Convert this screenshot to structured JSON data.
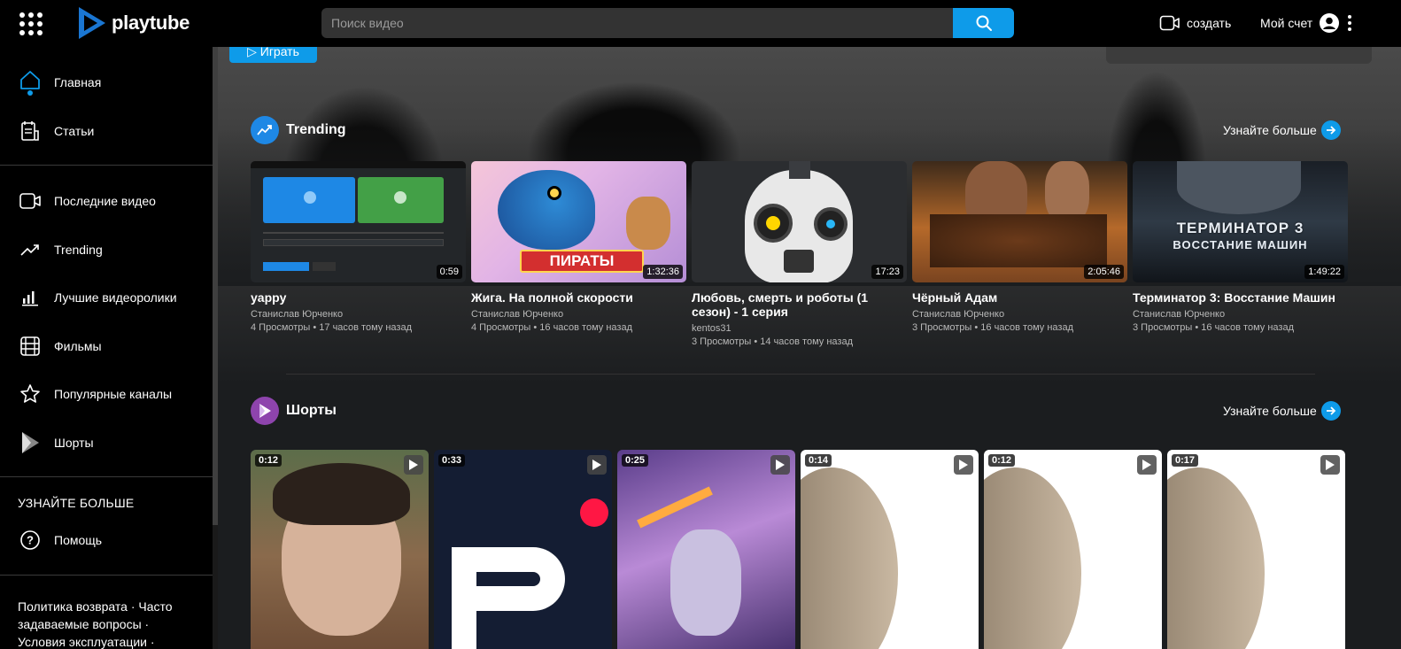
{
  "header": {
    "logo_text": "playtube",
    "search_placeholder": "Поиск видео",
    "create_label": "создать",
    "account_label": "Мой счет"
  },
  "sidebar": {
    "items": [
      {
        "label": "Главная",
        "icon": "home-icon"
      },
      {
        "label": "Статьи",
        "icon": "articles-icon"
      },
      {
        "label": "Последние видео",
        "icon": "video-camera-icon"
      },
      {
        "label": "Trending",
        "icon": "trending-icon"
      },
      {
        "label": "Лучшие видеоролики",
        "icon": "bar-chart-icon"
      },
      {
        "label": "Фильмы",
        "icon": "film-icon"
      },
      {
        "label": "Популярные каналы",
        "icon": "star-icon"
      },
      {
        "label": "Шорты",
        "icon": "shorts-icon"
      }
    ],
    "section_title": "УЗНАЙТЕ БОЛЬШЕ",
    "help_label": "Помощь",
    "footer_text": "Политика возврата · Часто задаваемые вопросы · Условия эксплуатации ·"
  },
  "hero": {
    "play_label": "Играть"
  },
  "trending": {
    "title": "Trending",
    "more_label": "Узнайте больше",
    "videos": [
      {
        "title": "yappy",
        "channel": "Станислав Юрченко",
        "meta": "4 Просмотры • 17 часов тому назад",
        "duration": "0:59"
      },
      {
        "title": "Жига. На полной скорости",
        "channel": "Станислав Юрченко",
        "meta": "4 Просмотры • 16 часов тому назад",
        "duration": "1:32:36"
      },
      {
        "title": "Любовь, смерть и роботы (1 сезон) - 1 серия",
        "channel": "kentos31",
        "meta": "3 Просмотры • 14 часов тому назад",
        "duration": "17:23"
      },
      {
        "title": "Чёрный Адам",
        "channel": "Станислав Юрченко",
        "meta": "3 Просмотры • 16 часов тому назад",
        "duration": "2:05:46"
      },
      {
        "title": "Терминатор 3: Восстание Машин",
        "channel": "Станислав Юрченко",
        "meta": "3 Просмотры • 16 часов тому назад",
        "duration": "1:49:22"
      }
    ],
    "thumb_text": {
      "pirates": "ПИРАТЫ",
      "terminator_line1": "ТЕРМИНАТОР 3",
      "terminator_line2": "ВОССТАНИЕ МАШИН"
    }
  },
  "shorts": {
    "title": "Шорты",
    "more_label": "Узнайте больше",
    "items": [
      {
        "duration": "0:12"
      },
      {
        "duration": "0:33"
      },
      {
        "duration": "0:25"
      },
      {
        "duration": "0:14"
      },
      {
        "duration": "0:12"
      },
      {
        "duration": "0:17"
      }
    ]
  },
  "colors": {
    "accent": "#0e9be9",
    "trending_icon_bg": "#1e88e5",
    "shorts_icon_bg": "#8e44ad"
  }
}
